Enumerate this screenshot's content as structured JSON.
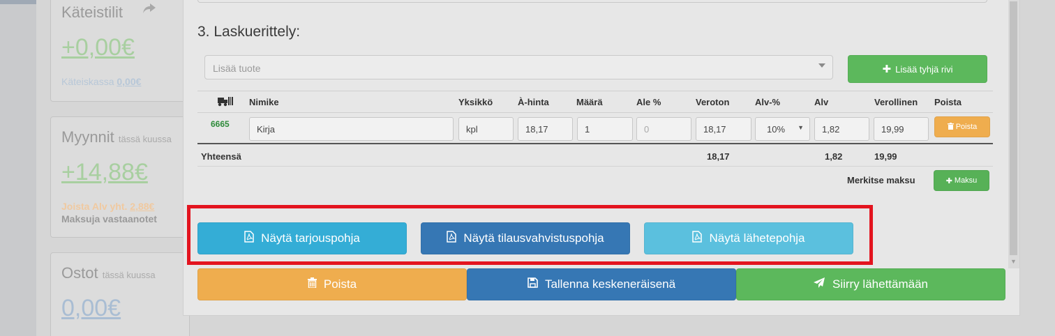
{
  "background": {
    "cards": [
      {
        "title": "Käteistilit",
        "subtitle": "",
        "value": "+0,00€",
        "line1_label": "Käteiskassa",
        "line1_value": "0,00€"
      },
      {
        "title": "Myynnit",
        "subtitle": "tässä kuussa",
        "value": "+14,88€",
        "line1_label": "Joista Alv yht.",
        "line1_value": "2,88€",
        "line2": "Maksuja vastaanotet"
      },
      {
        "title": "Ostot",
        "subtitle": "tässä kuussa",
        "value": "0,00€"
      }
    ]
  },
  "modal": {
    "section_title": "3. Laskuerittely:",
    "product_select_placeholder": "Lisää tuote",
    "add_empty_row_label": "Lisää tyhjä rivi",
    "table": {
      "headers": [
        "Nimike",
        "Yksikkö",
        "À-hinta",
        "Määrä",
        "Ale %",
        "Veroton",
        "Alv-%",
        "Alv",
        "Verollinen",
        "Poista"
      ],
      "rows": [
        {
          "code": "6665",
          "name": "Kirja",
          "unit": "kpl",
          "unit_price": "18,17",
          "quantity": "1",
          "discount": "0",
          "net": "18,17",
          "vat_pct": "10%",
          "vat": "1,82",
          "gross": "19,99",
          "delete_label": "Poista"
        }
      ],
      "totals": {
        "label": "Yhteensä",
        "net": "18,17",
        "vat": "1,82",
        "gross": "19,99"
      }
    },
    "mark_payment_label": "Merkitse maksu",
    "payment_button_label": "Maksu",
    "preview_buttons": {
      "offer": "Näytä tarjouspohja",
      "order_confirmation": "Näytä tilausvahvistuspohja",
      "delivery_note": "Näytä lähetepohja"
    },
    "actions": {
      "delete": "Poista",
      "save_draft": "Tallenna keskeneräisenä",
      "send": "Siirry lähettämään"
    }
  }
}
